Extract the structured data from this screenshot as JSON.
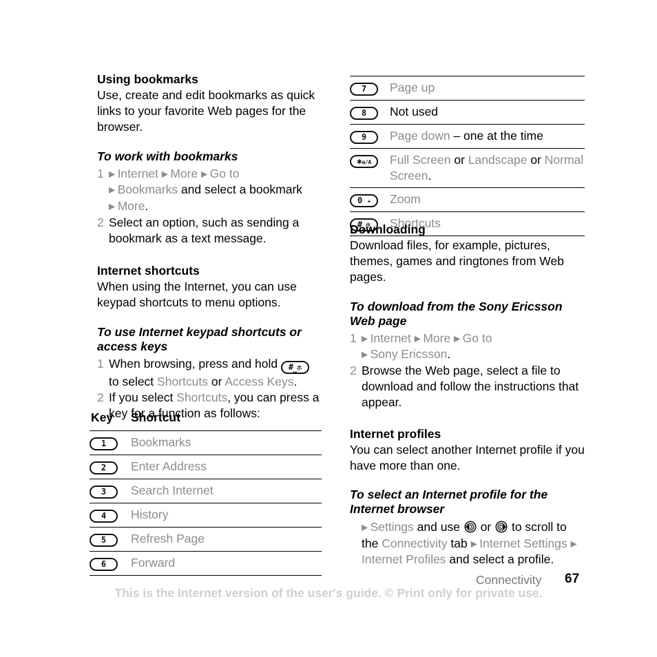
{
  "document": {
    "page_number": "67",
    "chapter": "Connectivity",
    "watermark": "This is the Internet version of the user's guide. © Print only for private use."
  },
  "left_column": {
    "section_bookmarks": {
      "heading": "Using bookmarks",
      "paragraph": "Use, create and edit bookmarks as quick links to your favorite Web pages for the browser.",
      "procedure_heading": "To work with bookmarks",
      "steps": [
        {
          "number": "1",
          "lines": [
            [
              {
                "t": "bullet"
              },
              {
                "t": "gray",
                "v": "Internet "
              },
              {
                "t": "bullet"
              },
              {
                "t": "gray",
                "v": "More "
              },
              {
                "t": "bullet"
              },
              {
                "t": "gray",
                "v": "Go to"
              }
            ],
            [
              {
                "t": "bullet"
              },
              {
                "t": "gray",
                "v": "Bookmarks "
              },
              {
                "t": "black",
                "v": "and select a bookmark"
              }
            ],
            [
              {
                "t": "bullet"
              },
              {
                "t": "gray",
                "v": "More"
              },
              {
                "t": "black",
                "v": "."
              }
            ]
          ]
        },
        {
          "number": "2",
          "lines": [
            [
              {
                "t": "black",
                "v": "Select an option, such as sending a bookmark as a text message."
              }
            ]
          ]
        }
      ]
    },
    "section_shortcuts": {
      "heading": "Internet shortcuts",
      "paragraph": "When using the Internet, you can use keypad shortcuts to menu options.",
      "procedure_heading": "To use Internet keypad shortcuts or access keys",
      "steps": [
        {
          "number": "1",
          "lines": [
            [
              {
                "t": "black",
                "v": "When browsing, press and hold "
              },
              {
                "t": "key",
                "v": "hash-key"
              }
            ],
            [
              {
                "t": "black",
                "v": "to select "
              },
              {
                "t": "gray",
                "v": "Shortcuts"
              },
              {
                "t": "black",
                "v": " or "
              },
              {
                "t": "gray",
                "v": "Access Keys"
              },
              {
                "t": "black",
                "v": "."
              }
            ]
          ]
        },
        {
          "number": "2",
          "lines": [
            [
              {
                "t": "black",
                "v": "If you select "
              },
              {
                "t": "gray",
                "v": "Shortcuts"
              },
              {
                "t": "black",
                "v": ", you can press a key for a function as follows:"
              }
            ]
          ]
        }
      ]
    },
    "shortcut_table": {
      "headers": [
        "Key",
        "Shortcut"
      ],
      "rows": [
        {
          "key": "1",
          "key_kind": "digit",
          "label": "Bookmarks",
          "label_color": "gray"
        },
        {
          "key": "2",
          "key_kind": "digit",
          "label": "Enter Address",
          "label_color": "gray"
        },
        {
          "key": "3",
          "key_kind": "digit",
          "label": "Search Internet",
          "label_color": "gray"
        },
        {
          "key": "4",
          "key_kind": "digit",
          "label": "History",
          "label_color": "gray"
        },
        {
          "key": "5",
          "key_kind": "digit",
          "label": "Refresh Page",
          "label_color": "gray"
        },
        {
          "key": "6",
          "key_kind": "digit",
          "label": "Forward",
          "label_color": "gray"
        }
      ]
    }
  },
  "right_column": {
    "shortcut_table_continued": {
      "rows": [
        {
          "key": "7",
          "key_kind": "digit",
          "parts": [
            {
              "t": "gray",
              "v": "Page up"
            }
          ]
        },
        {
          "key": "8",
          "key_kind": "digit",
          "parts": [
            {
              "t": "black",
              "v": "Not used"
            }
          ]
        },
        {
          "key": "9",
          "key_kind": "digit",
          "parts": [
            {
              "t": "gray",
              "v": "Page down"
            },
            {
              "t": "black",
              "v": " – one at the time"
            }
          ]
        },
        {
          "key": "*a/A",
          "key_kind": "star",
          "parts": [
            {
              "t": "gray",
              "v": "Full Screen"
            },
            {
              "t": "black",
              "v": " or "
            },
            {
              "t": "gray",
              "v": "Landscape"
            },
            {
              "t": "black",
              "v": " or "
            },
            {
              "t": "gray",
              "v": "Normal Screen"
            },
            {
              "t": "black",
              "v": "."
            }
          ]
        },
        {
          "key": "0 +",
          "key_kind": "zero",
          "parts": [
            {
              "t": "gray",
              "v": "Zoom"
            }
          ]
        },
        {
          "key": "#",
          "key_kind": "hash",
          "parts": [
            {
              "t": "gray",
              "v": "Shortcuts"
            }
          ]
        }
      ]
    },
    "section_downloading": {
      "heading": "Downloading",
      "paragraph": "Download files, for example, pictures, themes, games and ringtones from Web pages.",
      "procedure_heading": "To download from the Sony Ericsson Web page",
      "steps": [
        {
          "number": "1",
          "lines": [
            [
              {
                "t": "bullet"
              },
              {
                "t": "gray",
                "v": "Internet "
              },
              {
                "t": "bullet"
              },
              {
                "t": "gray",
                "v": "More "
              },
              {
                "t": "bullet"
              },
              {
                "t": "gray",
                "v": "Go to"
              }
            ],
            [
              {
                "t": "bullet"
              },
              {
                "t": "gray",
                "v": "Sony Ericsson"
              },
              {
                "t": "black",
                "v": "."
              }
            ]
          ]
        },
        {
          "number": "2",
          "lines": [
            [
              {
                "t": "black",
                "v": "Browse the Web page, select a file to download and follow the instructions that appear."
              }
            ]
          ]
        }
      ]
    },
    "section_profiles": {
      "heading": "Internet profiles",
      "paragraph": "You can select another Internet profile if you have more than one.",
      "procedure_heading": "To select an Internet profile for the Internet browser",
      "bullet_step": [
        {
          "t": "bullet"
        },
        {
          "t": "gray",
          "v": "Settings"
        },
        {
          "t": "black",
          "v": " and use "
        },
        {
          "t": "navkey",
          "v": "nav-left-key"
        },
        {
          "t": "black",
          "v": " or "
        },
        {
          "t": "navkey",
          "v": "nav-right-key"
        },
        {
          "t": "black",
          "v": " to scroll to the "
        },
        {
          "t": "gray",
          "v": "Connectivity"
        },
        {
          "t": "black",
          "v": " tab "
        },
        {
          "t": "bullet"
        },
        {
          "t": "gray",
          "v": "Internet Settings "
        },
        {
          "t": "bullet"
        },
        {
          "t": "gray",
          "v": "Internet Profiles"
        },
        {
          "t": "black",
          "v": " and select a profile."
        }
      ]
    }
  },
  "colors": {
    "gray_text": "#8c8c8c",
    "black_text": "#000000",
    "rule": "#000000",
    "watermark": "#cfcfcf",
    "chapter": "#767676"
  }
}
